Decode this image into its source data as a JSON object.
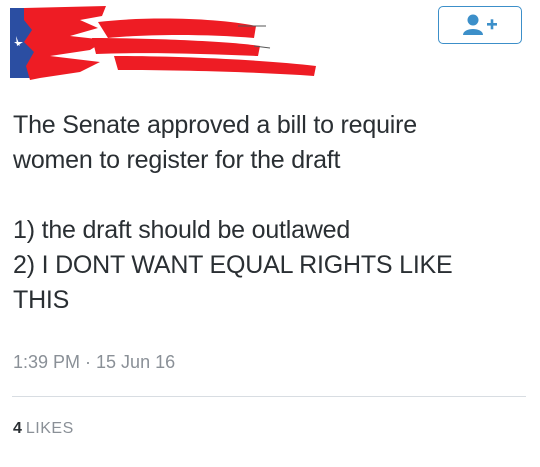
{
  "tweet": {
    "text_lines": [
      "The Senate approved a bill to require",
      "women to register for the draft",
      "",
      "1) the draft should be outlawed",
      "2) I DONT WANT EQUAL RIGHTS LIKE",
      "THIS"
    ],
    "timestamp": "1:39 PM · 15 Jun 16",
    "likes_count": "4",
    "likes_label": "LIKES"
  },
  "follow_button": {
    "icon": "follow-person-plus-icon"
  },
  "colors": {
    "redaction": "#ee1c24",
    "accent": "#3c8fc9",
    "text": "#2a2f33",
    "muted": "#8a9097"
  }
}
